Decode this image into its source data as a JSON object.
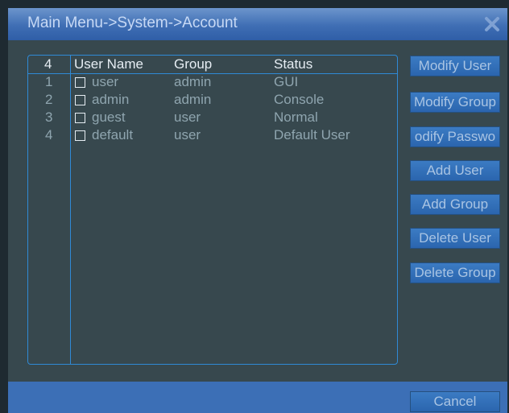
{
  "window": {
    "title": "Main Menu->System->Account"
  },
  "table": {
    "count": "4",
    "headers": {
      "user_name": "User Name",
      "group": "Group",
      "status": "Status"
    },
    "rows": [
      {
        "index": "1",
        "user_name": "user",
        "group": "admin",
        "status": "GUI",
        "checked": false
      },
      {
        "index": "2",
        "user_name": "admin",
        "group": "admin",
        "status": "Console",
        "checked": false
      },
      {
        "index": "3",
        "user_name": "guest",
        "group": "user",
        "status": "Normal",
        "checked": false
      },
      {
        "index": "4",
        "user_name": "default",
        "group": "user",
        "status": "Default User",
        "checked": false
      }
    ]
  },
  "buttons": {
    "modify_user": "Modify User",
    "modify_group": "Modify Group",
    "modify_password": "odify Passwo",
    "add_user": "Add User",
    "add_group": "Add Group",
    "delete_user": "Delete User",
    "delete_group": "Delete Group",
    "cancel": "Cancel"
  },
  "icons": {
    "close": "close-icon"
  },
  "colors": {
    "titlebar": "#3f6eb4",
    "panel": "#37484e",
    "border": "#2f8ad6",
    "button": "#2f6db6"
  }
}
